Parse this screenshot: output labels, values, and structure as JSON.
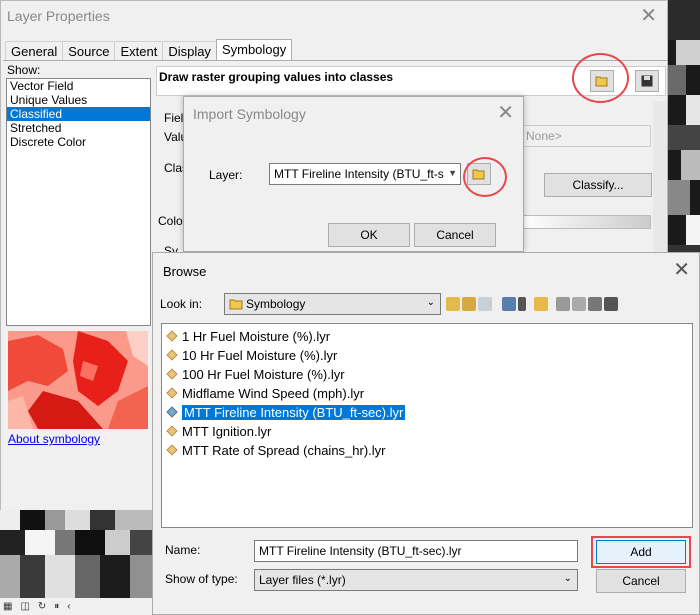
{
  "layer_properties": {
    "title": "Layer Properties",
    "tabs": [
      "General",
      "Source",
      "Extent",
      "Display",
      "Symbology"
    ],
    "active_tab": "Symbology",
    "show_label": "Show:",
    "show_items": [
      "Vector Field",
      "Unique Values",
      "Classified",
      "Stretched",
      "Discrete Color"
    ],
    "selected_show_item": "Classified",
    "heading": "Draw raster grouping values into classes",
    "about_link": "About symbology",
    "partial_labels": {
      "field": "Field",
      "value": "Valu",
      "class": "Clas",
      "color": "Color",
      "sy": "Sy"
    },
    "none_select": "None>",
    "classify_button": "Classify..."
  },
  "import_dialog": {
    "title": "Import Symbology",
    "layer_label": "Layer:",
    "layer_value": "MTT Fireline Intensity (BTU_ft-s",
    "ok_button": "OK",
    "cancel_button": "Cancel"
  },
  "browse_dialog": {
    "title": "Browse",
    "look_in_label": "Look in:",
    "look_in_value": "Symbology",
    "files": [
      "1 Hr Fuel Moisture (%).lyr",
      "10 Hr Fuel Moisture (%).lyr",
      "100 Hr Fuel Moisture (%).lyr",
      "Midflame Wind Speed (mph).lyr",
      "MTT Fireline Intensity (BTU_ft-sec).lyr",
      "MTT Ignition.lyr",
      "MTT Rate of Spread (chains_hr).lyr"
    ],
    "selected_file": "MTT Fireline Intensity (BTU_ft-sec).lyr",
    "name_label": "Name:",
    "name_value": "MTT Fireline Intensity (BTU_ft-sec).lyr",
    "type_label": "Show of type:",
    "type_value": "Layer files (*.lyr)",
    "add_button": "Add",
    "cancel_button": "Cancel"
  },
  "colors": {
    "accent": "#0078d7",
    "highlight_ring": "#e8474c"
  }
}
